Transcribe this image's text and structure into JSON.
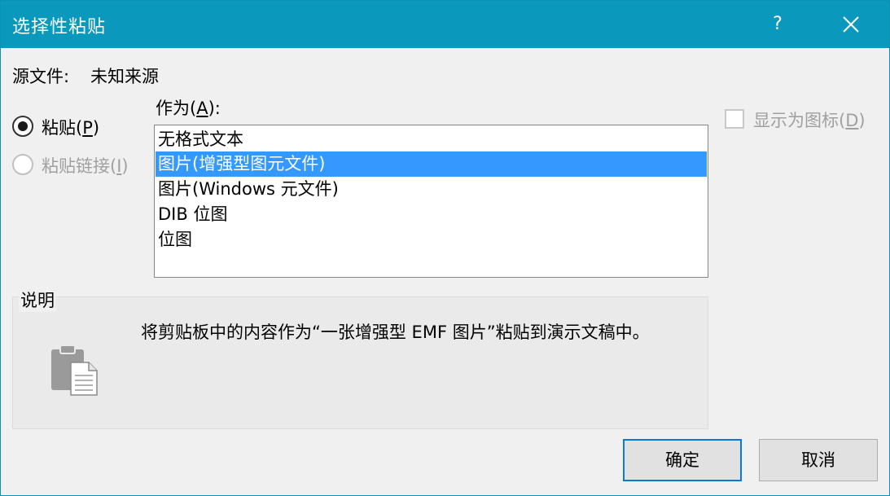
{
  "dialog": {
    "title": "选择性粘贴",
    "help_label": "?"
  },
  "source": {
    "label": "源文件:",
    "value": "未知来源"
  },
  "radios": {
    "paste_label": "粘贴",
    "paste_key": "P",
    "paste_selected": true,
    "paste_link_label": "粘贴链接",
    "paste_link_key": "I",
    "paste_link_enabled": false
  },
  "as": {
    "label": "作为",
    "key": "A",
    "suffix": ":",
    "items": [
      "无格式文本",
      "图片(增强型图元文件)",
      "图片(Windows 元文件)",
      "DIB 位图",
      "位图"
    ],
    "selected_index": 1
  },
  "display_as_icon": {
    "label": "显示为图标",
    "key": "D",
    "checked": false,
    "enabled": false
  },
  "description": {
    "group_label": "说明",
    "text": "将剪贴板中的内容作为“一张增强型 EMF 图片”粘贴到演示文稿中。",
    "icon": "clipboard-icon"
  },
  "buttons": {
    "ok": "确定",
    "cancel": "取消"
  },
  "colors": {
    "titlebar": "#0a98bd",
    "selection": "#3399ff",
    "default_button_border": "#0a78d7"
  }
}
